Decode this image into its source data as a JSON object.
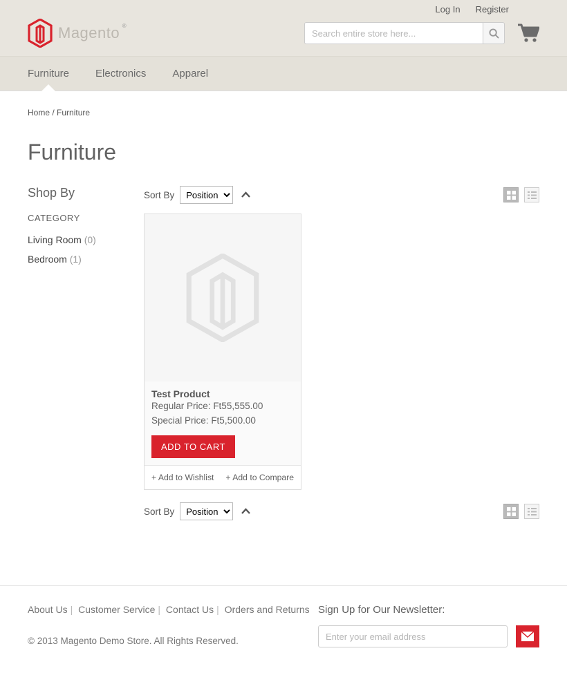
{
  "header": {
    "top_links": {
      "login": "Log In",
      "register": "Register"
    },
    "logo_text": "Magento",
    "search_placeholder": "Search entire store here..."
  },
  "nav": {
    "items": [
      {
        "label": "Furniture",
        "active": true
      },
      {
        "label": "Electronics",
        "active": false
      },
      {
        "label": "Apparel",
        "active": false
      }
    ]
  },
  "breadcrumb": {
    "home": "Home",
    "sep": " / ",
    "current": "Furniture"
  },
  "page_title": "Furniture",
  "sidebar": {
    "shop_by": "Shop By",
    "category_header": "CATEGORY",
    "categories": [
      {
        "label": "Living Room",
        "count": "(0)"
      },
      {
        "label": "Bedroom",
        "count": "(1)"
      }
    ]
  },
  "toolbar": {
    "sort_by_label": "Sort By",
    "sort_value": "Position"
  },
  "product": {
    "title": "Test Product",
    "regular_label": "Regular Price:",
    "regular_price": "Ft55,555.00",
    "special_label": "Special Price:",
    "special_price": "Ft5,500.00",
    "add_to_cart": "ADD TO CART",
    "wishlist": "+ Add to Wishlist",
    "compare": "+ Add to Compare"
  },
  "footer": {
    "links": {
      "about": "About Us",
      "customer_service": "Customer Service",
      "contact": "Contact Us",
      "orders": "Orders and Returns"
    },
    "copyright": "© 2013 Magento Demo Store. All Rights Reserved.",
    "newsletter": {
      "title": "Sign Up for Our Newsletter:",
      "placeholder": "Enter your email address"
    }
  }
}
